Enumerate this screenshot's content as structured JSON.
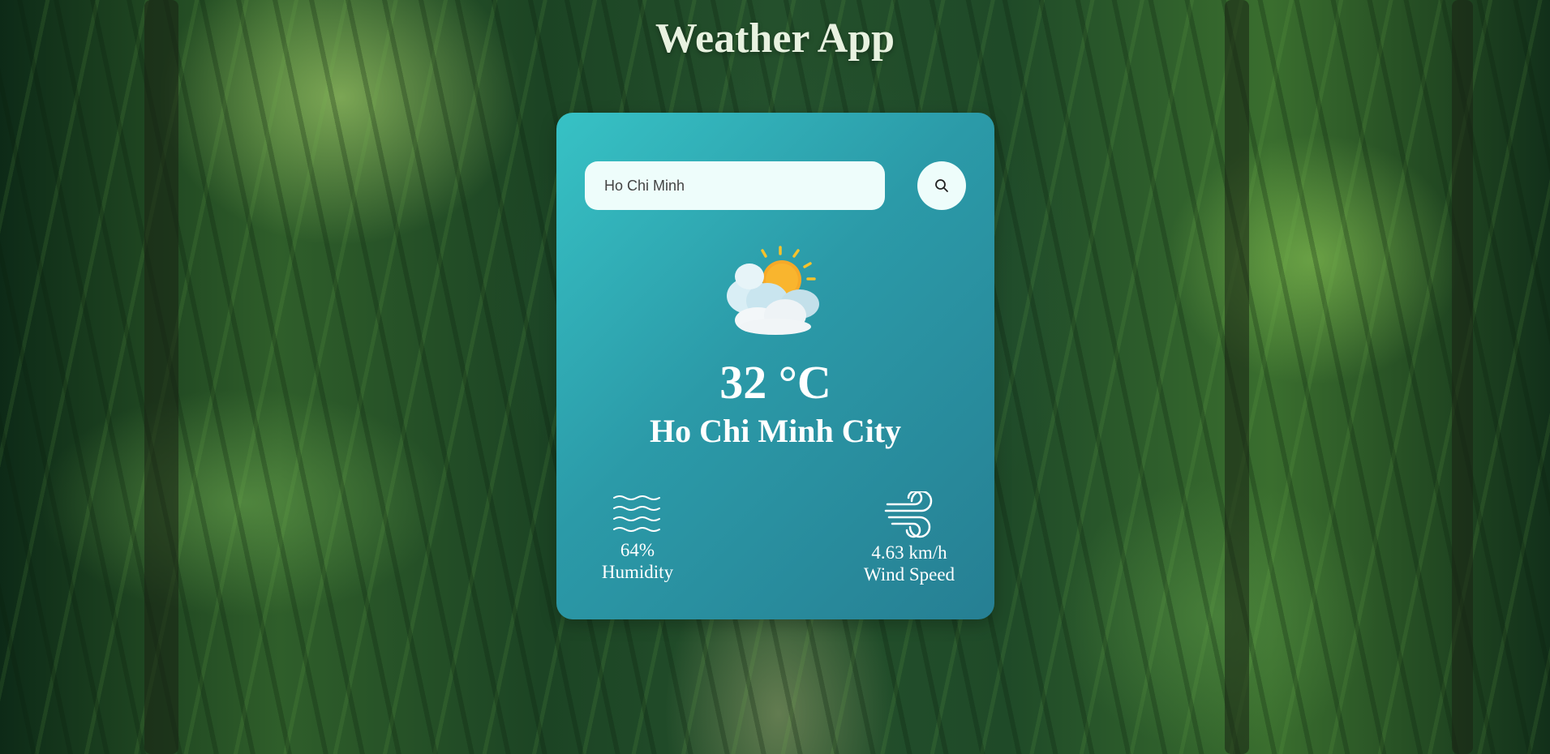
{
  "header": {
    "title": "Weather App"
  },
  "search": {
    "value": "Ho Chi Minh",
    "button_icon": "search-icon"
  },
  "weather": {
    "icon": "partly-cloudy-icon",
    "temperature": "32 °C",
    "city": "Ho Chi Minh City"
  },
  "details": {
    "humidity": {
      "icon": "humidity-waves-icon",
      "value": "64%",
      "label": "Humidity"
    },
    "wind": {
      "icon": "wind-icon",
      "value": "4.63 km/h",
      "label": "Wind Speed"
    }
  },
  "colors": {
    "card_gradient_start": "#37c2c5",
    "card_gradient_end": "#267f93",
    "input_background": "#eefdfb",
    "text": "#ffffff"
  }
}
